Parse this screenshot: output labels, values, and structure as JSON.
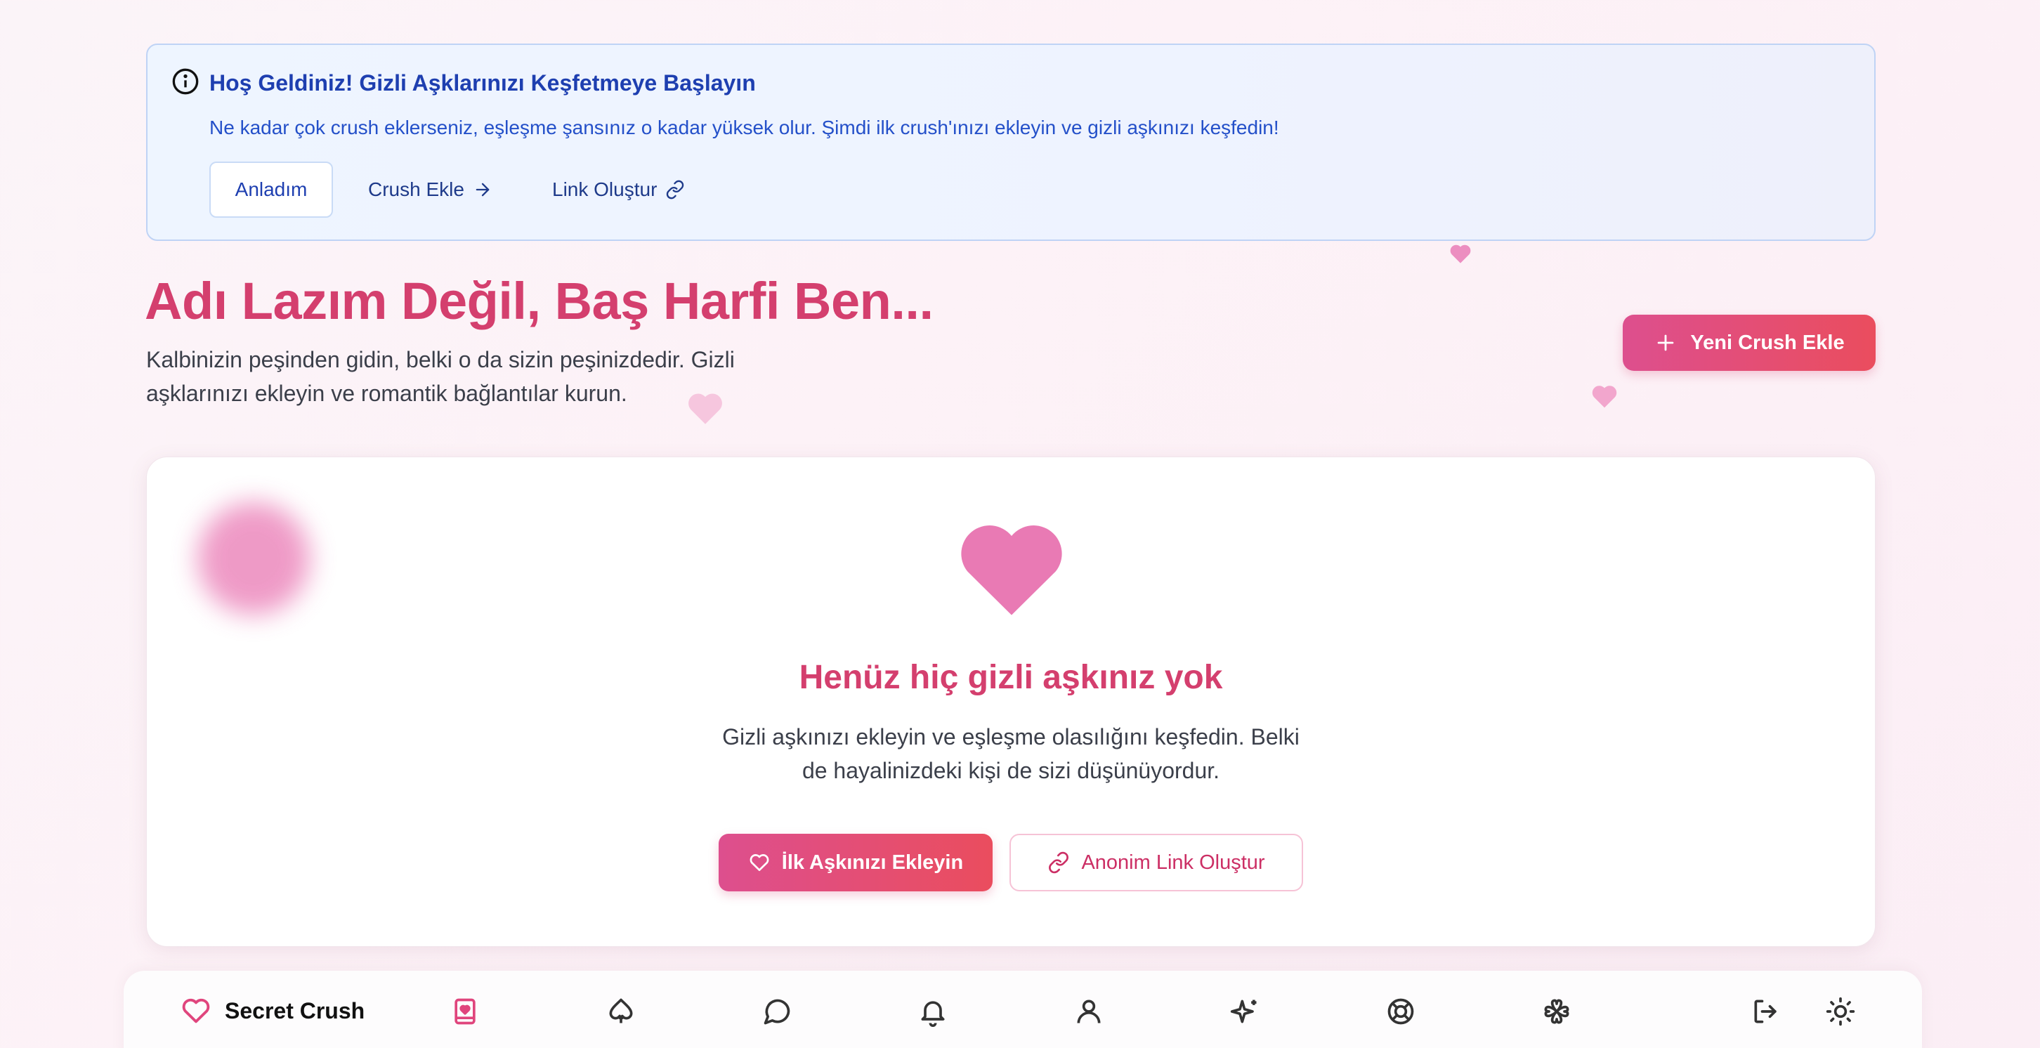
{
  "banner": {
    "title": "Hoş Geldiniz! Gizli Aşklarınızı Keşfetmeye Başlayın",
    "description": "Ne kadar çok crush eklerseniz, eşleşme şansınız o kadar yüksek olur. Şimdi ilk crush'ınızı ekleyin ve gizli aşkınızı keşfedin!",
    "ack_label": "Anladım",
    "add_crush_label": "Crush Ekle",
    "create_link_label": "Link Oluştur"
  },
  "hero": {
    "title": "Adı Lazım Değil, Baş Harfi Ben...",
    "subtitle": "Kalbinizin peşinden gidin, belki o da sizin peşinizdedir. Gizli aşklarınızı ekleyin ve romantik bağlantılar kurun.",
    "new_crush_label": "Yeni Crush Ekle"
  },
  "empty_state": {
    "title": "Henüz hiç gizli aşkınız yok",
    "description_line1": "Gizli aşkınızı ekleyin ve eşleşme olasılığını keşfedin. Belki",
    "description_line2": "de hayalinizdeki kişi de sizi düşünüyordur.",
    "primary_label": "İlk Aşkınızı Ekleyin",
    "secondary_label": "Anonim Link Oluştur"
  },
  "nav": {
    "brand": "Secret Crush",
    "items": [
      "book-heart-icon",
      "spade-icon",
      "chat-icon",
      "bell-icon",
      "user-icon",
      "sparkles-icon",
      "lifebuoy-icon",
      "clover-icon",
      "logout-icon",
      "sun-icon"
    ]
  },
  "colors": {
    "accent": "#d43f6e",
    "gradient_start": "#dd4f8e",
    "gradient_end": "#ea4d5e",
    "info_text": "#1e3fb0"
  }
}
